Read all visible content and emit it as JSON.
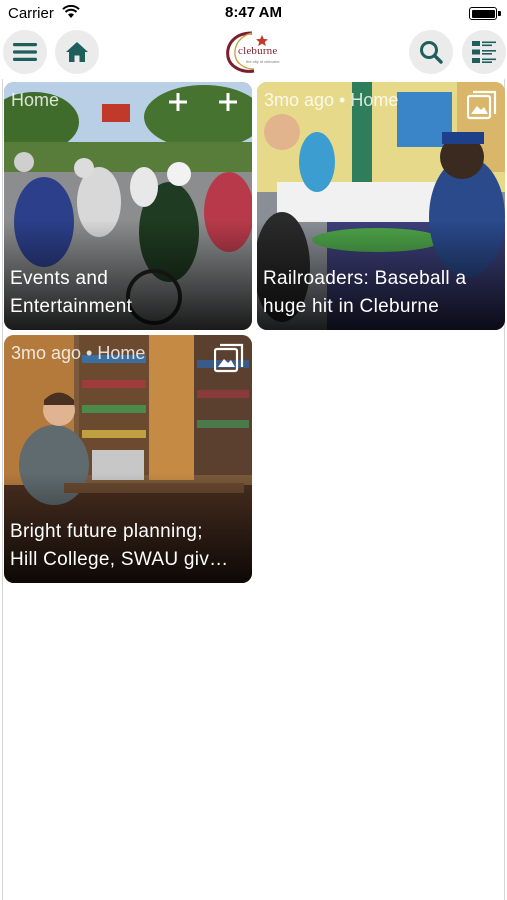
{
  "status_bar": {
    "carrier": "Carrier",
    "time": "8:47 AM"
  },
  "header": {
    "logo_text": "cleburne",
    "logo_subtext": "the city of cleburne",
    "accent_color": "#1f5f5b",
    "logo_color": "#7a1f2b"
  },
  "cards": [
    {
      "meta": "Home",
      "title_line1": "Events and",
      "title_line2": "Entertainment",
      "icon": "plus-icon"
    },
    {
      "meta": "3mo ago • Home",
      "title_line1": "Railroaders: Baseball a",
      "title_line2": "huge hit in Cleburne",
      "icon": "gallery-icon"
    },
    {
      "meta": "3mo ago • Home",
      "title_line1": "Bright future planning;",
      "title_line2": "Hill College, SWAU giv…",
      "icon": "gallery-icon"
    }
  ]
}
